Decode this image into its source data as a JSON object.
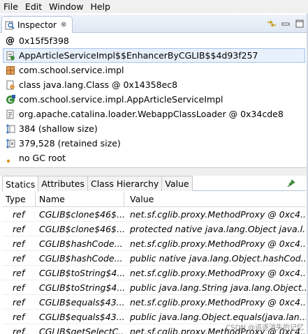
{
  "menubar": {
    "items": [
      {
        "label": "File"
      },
      {
        "label": "Edit"
      },
      {
        "label": "Window"
      },
      {
        "label": "Help"
      }
    ]
  },
  "view": {
    "tab_label": "Inspector",
    "close_glyph": "⊗"
  },
  "inspector": {
    "rows": [
      {
        "text": "0x15f5f398",
        "icon": "at-sign"
      },
      {
        "text": "AppArticleServiceImpl$$EnhancerByCGLIB$$4d93f257",
        "icon": "class-instance-icon"
      },
      {
        "text": "com.school.service.impl",
        "icon": "package-icon"
      },
      {
        "text": "class java.lang.Class @ 0x14358ec8",
        "icon": "class-object-icon"
      },
      {
        "text": "com.school.service.impl.AppArticleServiceImpl",
        "icon": "superclass-icon"
      },
      {
        "text": "org.apache.catalina.loader.WebappClassLoader @ 0x34cde8",
        "icon": "classloader-icon"
      },
      {
        "text": "384 (shallow size)",
        "icon": "shallow-size-icon"
      },
      {
        "text": "379,528 (retained size)",
        "icon": "retained-size-icon"
      },
      {
        "text": "no GC root",
        "icon": "gc-root-icon"
      }
    ]
  },
  "subtabs": [
    {
      "label": "Statics"
    },
    {
      "label": "Attributes"
    },
    {
      "label": "Class Hierarchy"
    },
    {
      "label": "Value"
    }
  ],
  "table": {
    "headers": [
      "Type",
      "Name",
      "Value"
    ],
    "rows": [
      {
        "type": "ref",
        "name": "CGLIB$clone$46$...",
        "value": "net.sf.cglib.proxy.MethodProxy @ 0xc4..."
      },
      {
        "type": "ref",
        "name": "CGLIB$clone$46$...",
        "value": "protected native java.lang.Object java.l..."
      },
      {
        "type": "ref",
        "name": "CGLIB$hashCode...",
        "value": "net.sf.cglib.proxy.MethodProxy @ 0xc4..."
      },
      {
        "type": "ref",
        "name": "CGLIB$hashCode...",
        "value": "public native  java.lang.Object.hashCod..."
      },
      {
        "type": "ref",
        "name": "CGLIB$toString$4...",
        "value": "net.sf.cglib.proxy.MethodProxy @ 0xc4..."
      },
      {
        "type": "ref",
        "name": "CGLIB$toString$4...",
        "value": "public java.lang.String java.lang.Object...."
      },
      {
        "type": "ref",
        "name": "CGLIB$equals$43...",
        "value": "net.sf.cglib.proxy.MethodProxy @ 0xc4..."
      },
      {
        "type": "ref",
        "name": "CGLIB$equals$43...",
        "value": "public  java.lang.Object.equals(java.lan..."
      },
      {
        "type": "ref",
        "name": "CGLIB$getSelectC...",
        "value": "net.sf.cglib.proxy.MethodProxy @ 0xc4..."
      }
    ]
  },
  "watermark": "CSDN @追逐消失的记忆"
}
